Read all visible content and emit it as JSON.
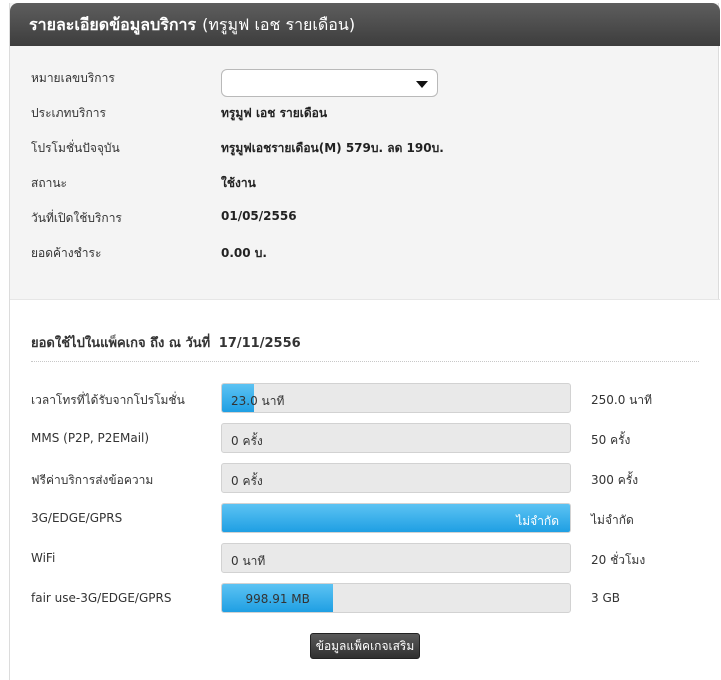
{
  "header": {
    "title": "รายละเอียดข้อมูลบริการ",
    "subtitle": "(ทรูมูฟ เอช รายเดือน)"
  },
  "service_info": {
    "number_label": "หมายเลขบริการ",
    "number_select_value": "",
    "rows": [
      {
        "label": "ประเภทบริการ",
        "value": "ทรูมูฟ เอช รายเดือน"
      },
      {
        "label": "โปรโมชั่นปัจจุบัน",
        "value": "ทรูมูฟเอชรายเดือน(M) 579บ. ลด 190บ."
      },
      {
        "label": "สถานะ",
        "value": "ใช้งาน"
      },
      {
        "label": "วันที่เปิดใช้บริการ",
        "value": "01/05/2556"
      },
      {
        "label": "ยอดค้างชำระ",
        "value": "0.00 บ."
      }
    ]
  },
  "usage": {
    "title": "ยอดใช้ไปในแพ็คเกจ ถึง ณ วันที่",
    "date": "17/11/2556",
    "rows": [
      {
        "label": "เวลาโทรที่ได้รับจากโปรโมชั่น",
        "used": "23.0 นาที",
        "max": "250.0 นาที",
        "fill_fraction": 0.092
      },
      {
        "label": "MMS (P2P, P2EMail)",
        "used": "0 ครั้ง",
        "max": "50 ครั้ง",
        "fill_fraction": 0
      },
      {
        "label": "ฟรีค่าบริการส่งข้อความ",
        "used": "0 ครั้ง",
        "max": "300 ครั้ง",
        "fill_fraction": 0
      },
      {
        "label": "3G/EDGE/GPRS",
        "used": "ไม่จำกัด",
        "max": "ไม่จำกัด",
        "fill_fraction": 1
      },
      {
        "label": "WiFi",
        "used": "0 นาที",
        "max": "20 ชั่วโมง",
        "fill_fraction": 0
      },
      {
        "label": "fair use-3G/EDGE/GPRS",
        "used": "998.91 MB",
        "max": "3 GB",
        "fill_fraction": 0.32
      }
    ],
    "extra_button_label": "ข้อมูลแพ็คเกจเสริม"
  },
  "colors": {
    "bar_fill": "#2ea8ea",
    "header_bg": "#4a4a4a"
  }
}
